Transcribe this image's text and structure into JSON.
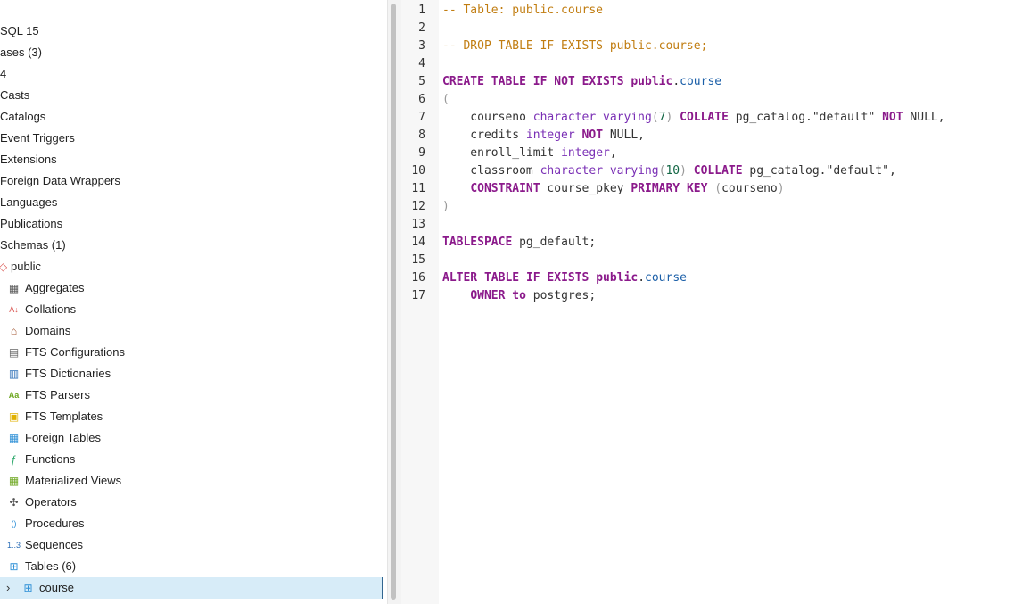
{
  "tree": {
    "items": [
      {
        "label": "SQL 15",
        "icon": "none"
      },
      {
        "label": "ases (3)",
        "icon": "none"
      },
      {
        "label": "4",
        "icon": "none"
      },
      {
        "label": "Casts",
        "icon": "none"
      },
      {
        "label": "Catalogs",
        "icon": "none"
      },
      {
        "label": "Event Triggers",
        "icon": "none"
      },
      {
        "label": "Extensions",
        "icon": "none"
      },
      {
        "label": "Foreign Data Wrappers",
        "icon": "none"
      },
      {
        "label": "Languages",
        "icon": "none"
      },
      {
        "label": "Publications",
        "icon": "none"
      },
      {
        "label": "Schemas (1)",
        "icon": "none"
      },
      {
        "label": "public",
        "icon": "schema-icon"
      },
      {
        "label": "Aggregates",
        "icon": "aggregates-icon"
      },
      {
        "label": "Collations",
        "icon": "collations-icon"
      },
      {
        "label": "Domains",
        "icon": "domains-icon"
      },
      {
        "label": "FTS Configurations",
        "icon": "fts-configurations-icon"
      },
      {
        "label": "FTS Dictionaries",
        "icon": "fts-dictionaries-icon"
      },
      {
        "label": "FTS Parsers",
        "icon": "fts-parsers-icon"
      },
      {
        "label": "FTS Templates",
        "icon": "fts-templates-icon"
      },
      {
        "label": "Foreign Tables",
        "icon": "foreign-tables-icon"
      },
      {
        "label": "Functions",
        "icon": "functions-icon"
      },
      {
        "label": "Materialized Views",
        "icon": "materialized-views-icon"
      },
      {
        "label": "Operators",
        "icon": "operators-icon"
      },
      {
        "label": "Procedures",
        "icon": "procedures-icon"
      },
      {
        "label": "Sequences",
        "icon": "sequences-icon"
      },
      {
        "label": "Tables (6)",
        "icon": "tables-icon"
      },
      {
        "label": "course",
        "icon": "table-icon",
        "selected": true
      }
    ],
    "expand_glyph": "›",
    "accent": "#326690",
    "selected_bg": "#d7ecf8"
  },
  "editor": {
    "line_numbers": [
      "1",
      "2",
      "3",
      "4",
      "5",
      "6",
      "7",
      "8",
      "9",
      "10",
      "11",
      "12",
      "13",
      "14",
      "15",
      "16",
      "17"
    ],
    "lines": [
      [
        {
          "t": "-- Table: public.course",
          "c": "cm"
        }
      ],
      [],
      [
        {
          "t": "-- DROP TABLE IF EXISTS public.course;",
          "c": "cm"
        }
      ],
      [],
      [
        {
          "t": "CREATE",
          "c": "kw"
        },
        {
          "t": " ",
          "c": "st"
        },
        {
          "t": "TABLE",
          "c": "kw"
        },
        {
          "t": " ",
          "c": "st"
        },
        {
          "t": "IF",
          "c": "kw"
        },
        {
          "t": " ",
          "c": "st"
        },
        {
          "t": "NOT",
          "c": "kw"
        },
        {
          "t": " ",
          "c": "st"
        },
        {
          "t": "EXISTS",
          "c": "kw"
        },
        {
          "t": " ",
          "c": "st"
        },
        {
          "t": "public",
          "c": "kw"
        },
        {
          "t": ".",
          "c": "st"
        },
        {
          "t": "course",
          "c": "vr"
        }
      ],
      [
        {
          "t": "(",
          "c": "pn"
        }
      ],
      [
        {
          "t": "    courseno ",
          "c": "st"
        },
        {
          "t": "character varying",
          "c": "ty"
        },
        {
          "t": "(",
          "c": "pn"
        },
        {
          "t": "7",
          "c": "nm"
        },
        {
          "t": ")",
          "c": "pn"
        },
        {
          "t": " ",
          "c": "st"
        },
        {
          "t": "COLLATE",
          "c": "kw"
        },
        {
          "t": " pg_catalog.\"default\" ",
          "c": "st"
        },
        {
          "t": "NOT",
          "c": "kw"
        },
        {
          "t": " NULL,",
          "c": "st"
        }
      ],
      [
        {
          "t": "    credits ",
          "c": "st"
        },
        {
          "t": "integer",
          "c": "ty"
        },
        {
          "t": " ",
          "c": "st"
        },
        {
          "t": "NOT",
          "c": "kw"
        },
        {
          "t": " NULL,",
          "c": "st"
        }
      ],
      [
        {
          "t": "    enroll_limit ",
          "c": "st"
        },
        {
          "t": "integer",
          "c": "ty"
        },
        {
          "t": ",",
          "c": "st"
        }
      ],
      [
        {
          "t": "    classroom ",
          "c": "st"
        },
        {
          "t": "character varying",
          "c": "ty"
        },
        {
          "t": "(",
          "c": "pn"
        },
        {
          "t": "10",
          "c": "nm"
        },
        {
          "t": ")",
          "c": "pn"
        },
        {
          "t": " ",
          "c": "st"
        },
        {
          "t": "COLLATE",
          "c": "kw"
        },
        {
          "t": " pg_catalog.\"default\",",
          "c": "st"
        }
      ],
      [
        {
          "t": "    ",
          "c": "st"
        },
        {
          "t": "CONSTRAINT",
          "c": "kw"
        },
        {
          "t": " course_pkey ",
          "c": "st"
        },
        {
          "t": "PRIMARY",
          "c": "kw"
        },
        {
          "t": " ",
          "c": "st"
        },
        {
          "t": "KEY",
          "c": "kw"
        },
        {
          "t": " ",
          "c": "st"
        },
        {
          "t": "(",
          "c": "pn"
        },
        {
          "t": "courseno",
          "c": "st"
        },
        {
          "t": ")",
          "c": "pn"
        }
      ],
      [
        {
          "t": ")",
          "c": "pn"
        }
      ],
      [],
      [
        {
          "t": "TABLESPACE",
          "c": "kw"
        },
        {
          "t": " pg_default;",
          "c": "st"
        }
      ],
      [],
      [
        {
          "t": "ALTER",
          "c": "kw"
        },
        {
          "t": " ",
          "c": "st"
        },
        {
          "t": "TABLE",
          "c": "kw"
        },
        {
          "t": " ",
          "c": "st"
        },
        {
          "t": "IF",
          "c": "kw"
        },
        {
          "t": " ",
          "c": "st"
        },
        {
          "t": "EXISTS",
          "c": "kw"
        },
        {
          "t": " ",
          "c": "st"
        },
        {
          "t": "public",
          "c": "kw"
        },
        {
          "t": ".",
          "c": "st"
        },
        {
          "t": "course",
          "c": "vr"
        }
      ],
      [
        {
          "t": "    ",
          "c": "st"
        },
        {
          "t": "OWNER",
          "c": "kw"
        },
        {
          "t": " ",
          "c": "st"
        },
        {
          "t": "to",
          "c": "kw"
        },
        {
          "t": " postgres;",
          "c": "st"
        }
      ]
    ]
  }
}
